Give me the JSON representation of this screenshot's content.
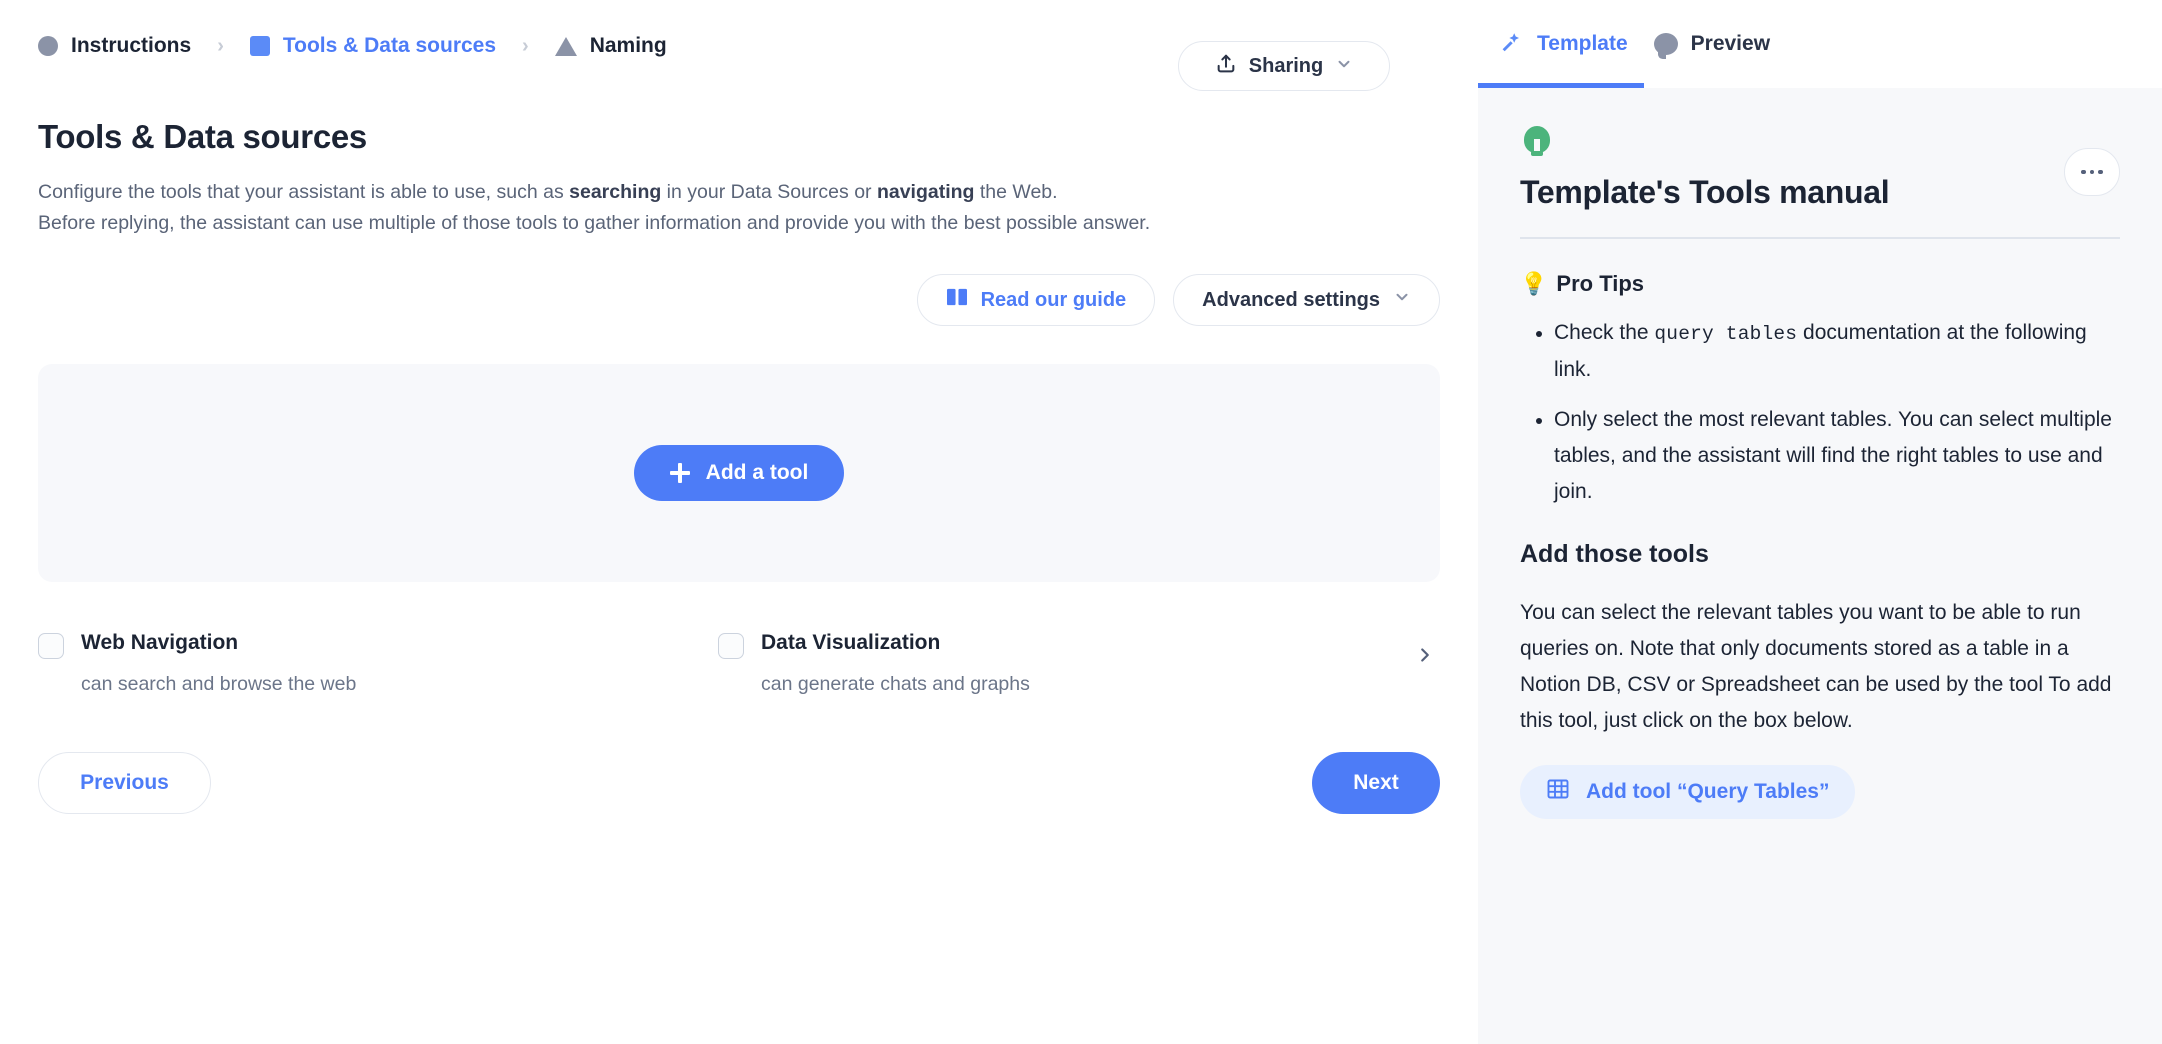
{
  "breadcrumb": {
    "items": [
      {
        "label": "Instructions",
        "shape": "circle-icon",
        "active": false
      },
      {
        "label": "Tools & Data sources",
        "shape": "square-icon",
        "active": true
      },
      {
        "label": "Naming",
        "shape": "triangle-icon",
        "active": false
      }
    ],
    "separator": "›"
  },
  "header": {
    "sharing_label": "Sharing"
  },
  "page": {
    "title": "Tools & Data sources",
    "desc_line1_a": "Configure the tools that your assistant is able to use, such as ",
    "desc_line1_b": "searching",
    "desc_line1_c": " in your Data Sources or ",
    "desc_line1_d": "navigating",
    "desc_line1_e": " the Web.",
    "desc_line2": "Before replying, the assistant can use multiple of those tools to gather information and provide you with the best possible answer."
  },
  "toolbar": {
    "read_guide_label": "Read our guide",
    "advanced_settings_label": "Advanced settings"
  },
  "tool_panel": {
    "add_tool_label": "Add a tool"
  },
  "capabilities": [
    {
      "name": "Web Navigation",
      "sub": "can search and browse the web",
      "checked": false
    },
    {
      "name": "Data Visualization",
      "sub": "can generate chats and graphs",
      "checked": false
    }
  ],
  "nav": {
    "previous_label": "Previous",
    "next_label": "Next"
  },
  "side": {
    "tabs": [
      {
        "label": "Template",
        "icon": "magic-wand-icon",
        "active": true
      },
      {
        "label": "Preview",
        "icon": "chat-bubble-icon",
        "active": false
      }
    ],
    "title": "Template's Tools manual",
    "tips_emoji": "💡",
    "tips_heading": "Pro Tips",
    "tips": [
      {
        "before": "Check the ",
        "code": "query tables",
        "after": " documentation at the following link."
      },
      {
        "before": "Only select the most relevant tables. You can select multiple tables, and the assistant will find the right tables to use and join.",
        "code": "",
        "after": ""
      }
    ],
    "section_heading": "Add those tools",
    "section_paragraph": "You can select the relevant tables you want to be able to run queries on. Note that only documents stored as a table in a Notion DB, CSV or Spreadsheet can be used by the tool To add this tool, just click on the box below.",
    "add_query_tool_label": "Add tool “Query Tables”"
  },
  "colors": {
    "accent_blue": "#4d7cf7",
    "green": "#4cb47c",
    "panel_bg": "#f7f8fa",
    "tool_panel_bg": "#f7f8fb",
    "text_dark": "#1c2434",
    "text_muted": "#6b7589"
  }
}
